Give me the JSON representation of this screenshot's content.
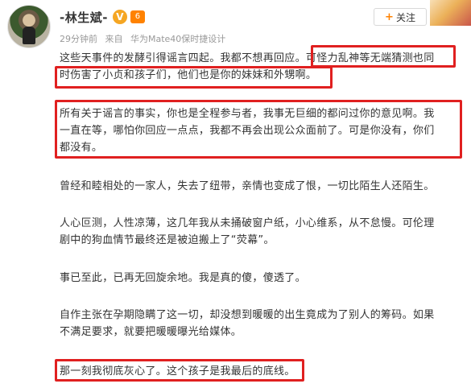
{
  "author": {
    "name": "-林生斌-",
    "verified_badge": "V",
    "level_badge": "6"
  },
  "follow_button": {
    "plus": "+",
    "label": "关注"
  },
  "meta": {
    "time": "29分钟前",
    "source_prefix": "来自",
    "device": "华为Mate40保时捷设计"
  },
  "post": {
    "p1_line1_a": "这些天事件的发酵引得谣言四起。我都不想再回应。",
    "p1_line1_b": "可怪力乱神等无端猜测也同",
    "p1_line2": "时伤害了小贞和孩子们，他们也是你的妹妹和外甥啊。",
    "p2_line1": "所有关于谣言的事实，你也是全程参与者，我事无巨细的都问过你的意见啊。我",
    "p2_line2": "一直在等，哪怕你回应一点点，我都不再会出现公众面前了。可是你没有，你们",
    "p2_line3": "都没有。",
    "p3": "曾经和睦相处的一家人，失去了纽带，亲情也变成了恨，一切比陌生人还陌生。",
    "p4_line1": "人心叵测，人性凉薄，这几年我从未捅破窗户纸，小心维系，从不怠慢。可伦理",
    "p4_line2": "剧中的狗血情节最终还是被迫搬上了“荧幕”。",
    "p5": "事已至此，已再无回旋余地。我是真的傻，傻透了。",
    "p6_line1": "自作主张在孕期隐瞒了这一切，却没想到暖暖的出生竟成为了别人的筹码。如果",
    "p6_line2": "不满足要求，就要把暖暖曝光给媒体。",
    "p7": "那一刻我彻底灰心了。这个孩子是我最后的底线。"
  },
  "colors": {
    "highlight_border": "#e02020",
    "meta_text": "#999999",
    "body_text": "#333333",
    "accent": "#ff8200"
  }
}
